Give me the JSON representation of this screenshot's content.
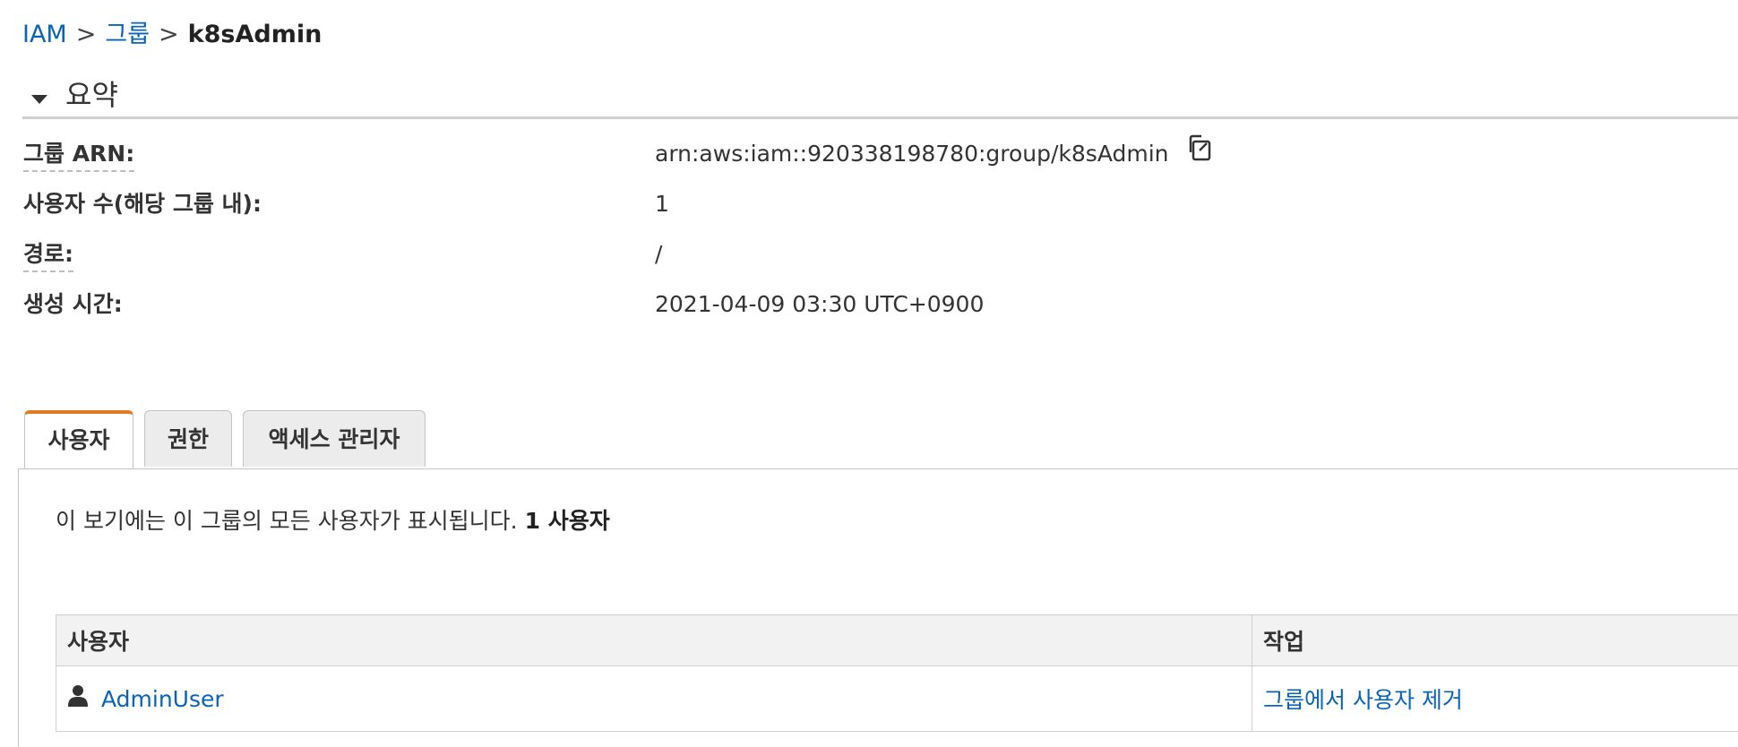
{
  "breadcrumb": {
    "iam": "IAM",
    "groups": "그룹",
    "current": "k8sAdmin",
    "separator": ">"
  },
  "summary": {
    "title": "요약",
    "rows": [
      {
        "label": "그룹 ARN:",
        "value": "arn:aws:iam::920338198780:group/k8sAdmin"
      },
      {
        "label": "사용자 수(해당 그룹 내):",
        "value": "1"
      },
      {
        "label": "경로:",
        "value": "/"
      },
      {
        "label": "생성 시간:",
        "value": "2021-04-09 03:30 UTC+0900"
      }
    ]
  },
  "tabs": [
    {
      "label": "사용자",
      "active": true
    },
    {
      "label": "권한",
      "active": false
    },
    {
      "label": "액세스 관리자",
      "active": false
    }
  ],
  "users_panel": {
    "description": "이 보기에는 이 그룹의 모든 사용자가 표시됩니다.",
    "count_text": "1 사용자",
    "columns": [
      "사용자",
      "작업"
    ],
    "rows": [
      {
        "user": "AdminUser",
        "action": "그룹에서 사용자 제거"
      }
    ]
  },
  "icons": {
    "copy": "copy-icon",
    "user": "user-icon",
    "caret": "caret-down-icon"
  },
  "colors": {
    "link": "#0a63b8",
    "active_tab_accent": "#e07b24"
  }
}
